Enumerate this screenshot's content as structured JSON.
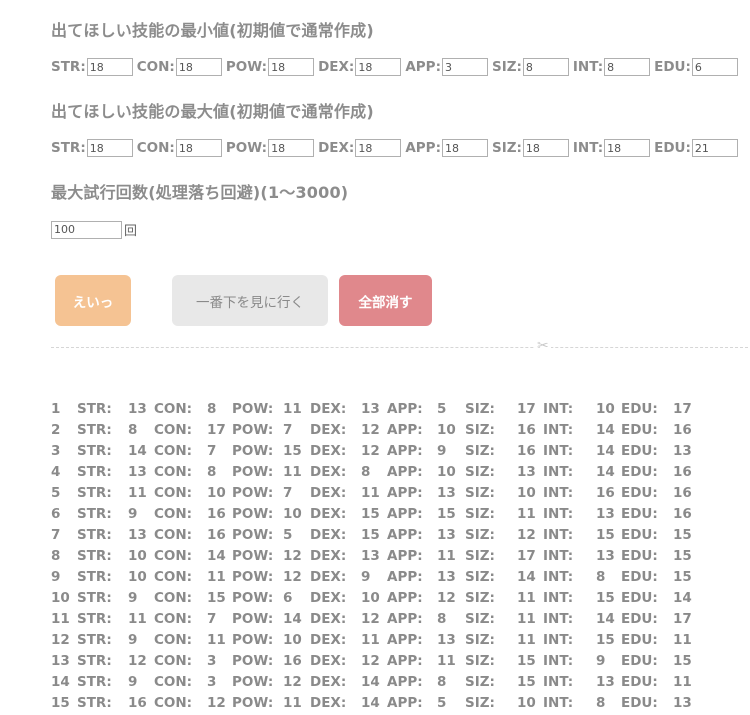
{
  "min_section": {
    "heading": "出てほしい技能の最小値(初期値で通常作成)",
    "fields": [
      {
        "label": "STR:",
        "value": "18"
      },
      {
        "label": "CON:",
        "value": "18"
      },
      {
        "label": "POW:",
        "value": "18"
      },
      {
        "label": "DEX:",
        "value": "18"
      },
      {
        "label": "APP:",
        "value": "3"
      },
      {
        "label": "SIZ:",
        "value": "8"
      },
      {
        "label": "INT:",
        "value": "8"
      },
      {
        "label": "EDU:",
        "value": "6"
      }
    ]
  },
  "max_section": {
    "heading": "出てほしい技能の最大値(初期値で通常作成)",
    "fields": [
      {
        "label": "STR:",
        "value": "18"
      },
      {
        "label": "CON:",
        "value": "18"
      },
      {
        "label": "POW:",
        "value": "18"
      },
      {
        "label": "DEX:",
        "value": "18"
      },
      {
        "label": "APP:",
        "value": "18"
      },
      {
        "label": "SIZ:",
        "value": "18"
      },
      {
        "label": "INT:",
        "value": "18"
      },
      {
        "label": "EDU:",
        "value": "21"
      }
    ]
  },
  "tries_section": {
    "heading": "最大試行回数(処理落ち回避)(1〜3000)",
    "value": "100",
    "unit": "回"
  },
  "buttons": {
    "go": "えいっ",
    "scroll_down": "一番下を見に行く",
    "clear": "全部消す"
  },
  "stat_labels": [
    "STR:",
    "CON:",
    "POW:",
    "DEX:",
    "APP:",
    "SIZ:",
    "INT:",
    "EDU:"
  ],
  "results": [
    {
      "n": "1",
      "v": [
        "13",
        "8",
        "11",
        "13",
        "5",
        "17",
        "10",
        "17"
      ]
    },
    {
      "n": "2",
      "v": [
        "8",
        "17",
        "7",
        "12",
        "10",
        "16",
        "14",
        "16"
      ]
    },
    {
      "n": "3",
      "v": [
        "14",
        "7",
        "15",
        "12",
        "9",
        "16",
        "14",
        "13"
      ]
    },
    {
      "n": "4",
      "v": [
        "13",
        "8",
        "11",
        "8",
        "10",
        "13",
        "14",
        "16"
      ]
    },
    {
      "n": "5",
      "v": [
        "11",
        "10",
        "7",
        "11",
        "13",
        "10",
        "16",
        "16"
      ]
    },
    {
      "n": "6",
      "v": [
        "9",
        "16",
        "10",
        "15",
        "15",
        "11",
        "13",
        "16"
      ]
    },
    {
      "n": "7",
      "v": [
        "13",
        "16",
        "5",
        "15",
        "13",
        "12",
        "15",
        "15"
      ]
    },
    {
      "n": "8",
      "v": [
        "10",
        "14",
        "12",
        "13",
        "11",
        "17",
        "13",
        "15"
      ]
    },
    {
      "n": "9",
      "v": [
        "10",
        "11",
        "12",
        "9",
        "13",
        "14",
        "8",
        "15"
      ]
    },
    {
      "n": "10",
      "v": [
        "9",
        "15",
        "6",
        "10",
        "12",
        "11",
        "15",
        "14"
      ]
    },
    {
      "n": "11",
      "v": [
        "11",
        "7",
        "14",
        "12",
        "8",
        "11",
        "14",
        "17"
      ]
    },
    {
      "n": "12",
      "v": [
        "9",
        "11",
        "10",
        "11",
        "13",
        "11",
        "15",
        "11"
      ]
    },
    {
      "n": "13",
      "v": [
        "12",
        "3",
        "16",
        "12",
        "11",
        "15",
        "9",
        "15"
      ]
    },
    {
      "n": "14",
      "v": [
        "9",
        "3",
        "12",
        "14",
        "8",
        "15",
        "13",
        "11"
      ]
    },
    {
      "n": "15",
      "v": [
        "16",
        "12",
        "11",
        "14",
        "5",
        "10",
        "8",
        "13"
      ]
    }
  ]
}
